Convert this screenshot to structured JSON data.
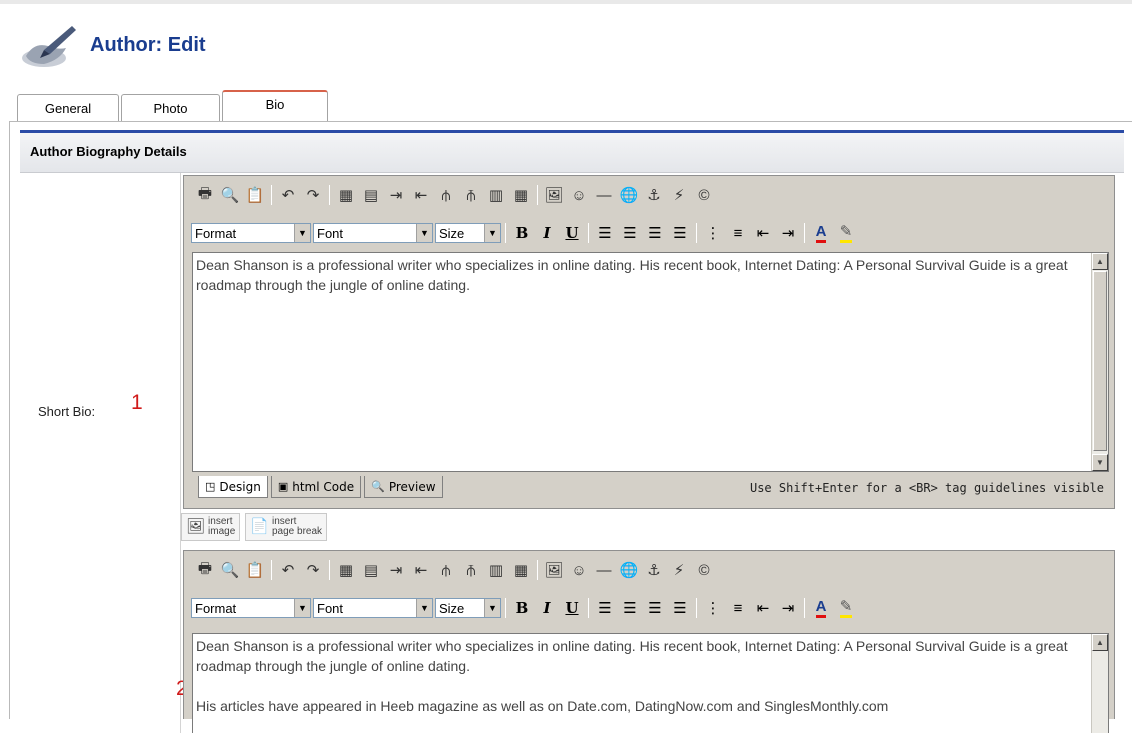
{
  "header": {
    "title": "Author:",
    "subtitle": "Edit",
    "logo_icon": "pen-hand-icon"
  },
  "tabs": [
    {
      "label": "General"
    },
    {
      "label": "Photo"
    },
    {
      "label": "Bio",
      "active": true
    }
  ],
  "section": {
    "title": "Author Biography Details"
  },
  "short_bio": {
    "label": "Short Bio:",
    "marker": "1"
  },
  "long_bio": {
    "marker": "2"
  },
  "toolbar": {
    "icons": [
      "print-icon",
      "find-icon",
      "paste-word-icon",
      "undo-icon",
      "redo-icon",
      "insert-table-icon",
      "edit-table-icon",
      "insert-column-icon",
      "delete-column-icon",
      "split-icon",
      "merge-icon",
      "insert-row-icon",
      "table-grid-icon",
      "image-icon",
      "smiley-icon",
      "horizontal-rule-icon",
      "link-icon",
      "anchor-icon",
      "flash-icon",
      "copyright-icon"
    ],
    "format_label": "Format",
    "font_label": "Font",
    "size_label": "Size"
  },
  "editor1": {
    "text": "Dean Shanson is a professional writer who specializes in online dating. His recent book, Internet Dating: A Personal Survival Guide is a great roadmap through the jungle of online dating."
  },
  "editor2": {
    "para1": "Dean Shanson is a professional writer who specializes in online dating. His recent book, Internet Dating: A Personal Survival Guide is a great roadmap through the jungle of online dating.",
    "para2": "His articles have appeared in Heeb magazine as well as on Date.com, DatingNow.com and SinglesMonthly.com"
  },
  "modes": [
    {
      "label": "Design",
      "icon": "design-icon",
      "active": true
    },
    {
      "label": "html Code",
      "icon": "code-icon"
    },
    {
      "label": "Preview",
      "icon": "preview-icon"
    }
  ],
  "hint": "Use Shift+Enter for a <BR> tag  guidelines visible",
  "insert_buttons": [
    {
      "line1": "insert",
      "line2": "image",
      "icon": "insert-image-icon"
    },
    {
      "line1": "insert",
      "line2": "page break",
      "icon": "page-break-icon"
    }
  ],
  "colors": {
    "title": "#1a3d8f",
    "active_tab_accent": "#d7624a",
    "section_rule": "#2a4ba6",
    "marker": "#d01a1a",
    "editor_bg": "#d4d0c8"
  }
}
